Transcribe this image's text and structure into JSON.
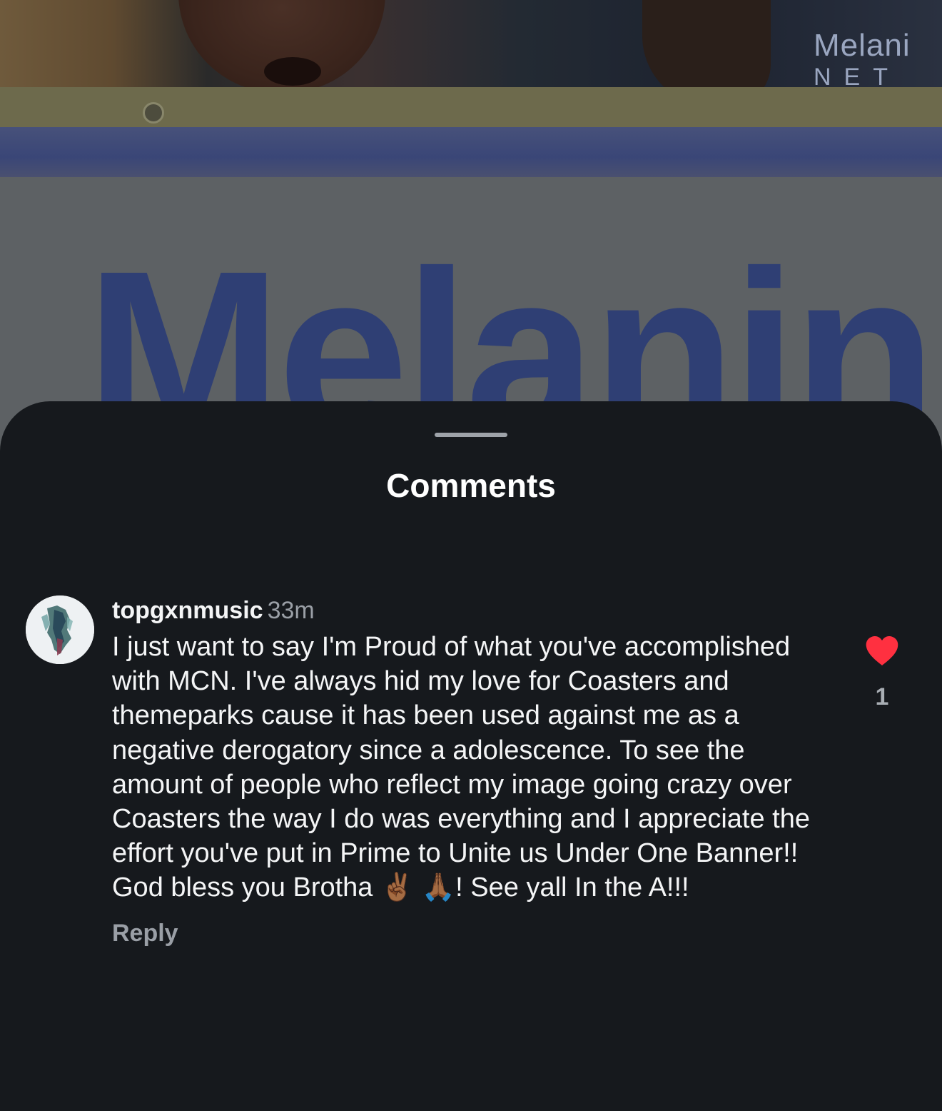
{
  "background": {
    "banner_text": "Melanin",
    "logo_line1": "Melani",
    "logo_line2": "NET"
  },
  "sheet": {
    "title": "Comments"
  },
  "comment": {
    "username": "topgxnmusic",
    "timestamp": "33m",
    "text": "I just want to say I'm Proud of what you've accomplished with MCN. I've always hid my love for Coasters and themeparks cause it has been used against me as a negative derogatory since a adolescence. To see the amount of people who reflect my image going crazy over Coasters the way I do was everything and I appreciate the effort you've put in Prime to Unite us Under One Banner!! God bless you Brotha ✌🏾 🙏🏾! See yall In the A!!!",
    "reply_label": "Reply",
    "like_count": "1",
    "like_icon": "heart-icon",
    "liked": true,
    "like_color": "#ff3040"
  }
}
